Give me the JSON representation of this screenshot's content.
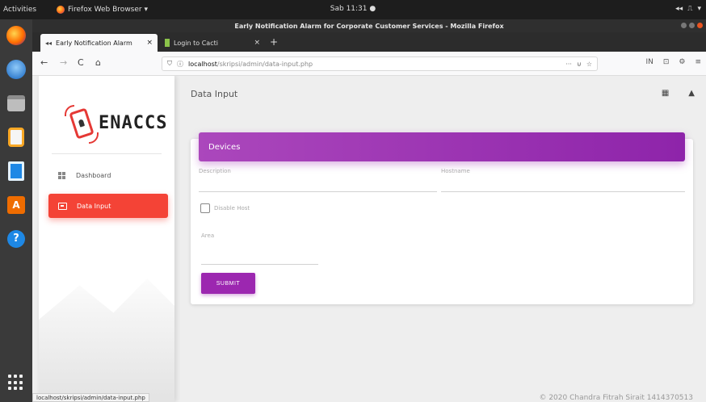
{
  "os": {
    "activities": "Activities",
    "app_menu": "Firefox Web Browser ▾",
    "clock": "Sab 11:31 ●",
    "tray": [
      "◂◂",
      "⎍",
      "▾"
    ]
  },
  "window": {
    "title": "Early Notification Alarm for Corporate Customer Services - Mozilla Firefox"
  },
  "tabs": [
    {
      "label": "Early Notification Alarm",
      "icon": "enaccs-favicon",
      "close": "×"
    },
    {
      "label": "Login to Cacti",
      "icon": "cacti-favicon",
      "close": "×"
    }
  ],
  "new_tab": "+",
  "nav": {
    "back": "←",
    "forward": "→",
    "reload": "C",
    "home": "⌂",
    "url_host": "localhost",
    "url_path": "/skripsi/admin/data-input.php",
    "url_more": "···",
    "pocket": "⊍",
    "bookmark": "☆",
    "library": "IN",
    "sidebar_toggle": "⊡",
    "extensions": "⚙",
    "menu": "≡"
  },
  "sidebar": {
    "brand": "ENACCS",
    "items": [
      {
        "label": "Dashboard",
        "icon": "dashboard-icon",
        "active": false
      },
      {
        "label": "Data Input",
        "icon": "input-icon",
        "active": true
      }
    ]
  },
  "main": {
    "page_title": "Data Input",
    "top_icons": [
      "▦",
      "▲"
    ],
    "card_title": "Devices",
    "form": {
      "description_label": "Description",
      "hostname_label": "Hostname",
      "disable_host_label": "Disable Host",
      "area_label": "Area",
      "submit_label": "SUBMIT"
    },
    "footer": "© 2020 Chandra Fitrah Sirait 1414370513"
  },
  "status_bar": "localhost/skripsi/admin/data-input.php"
}
